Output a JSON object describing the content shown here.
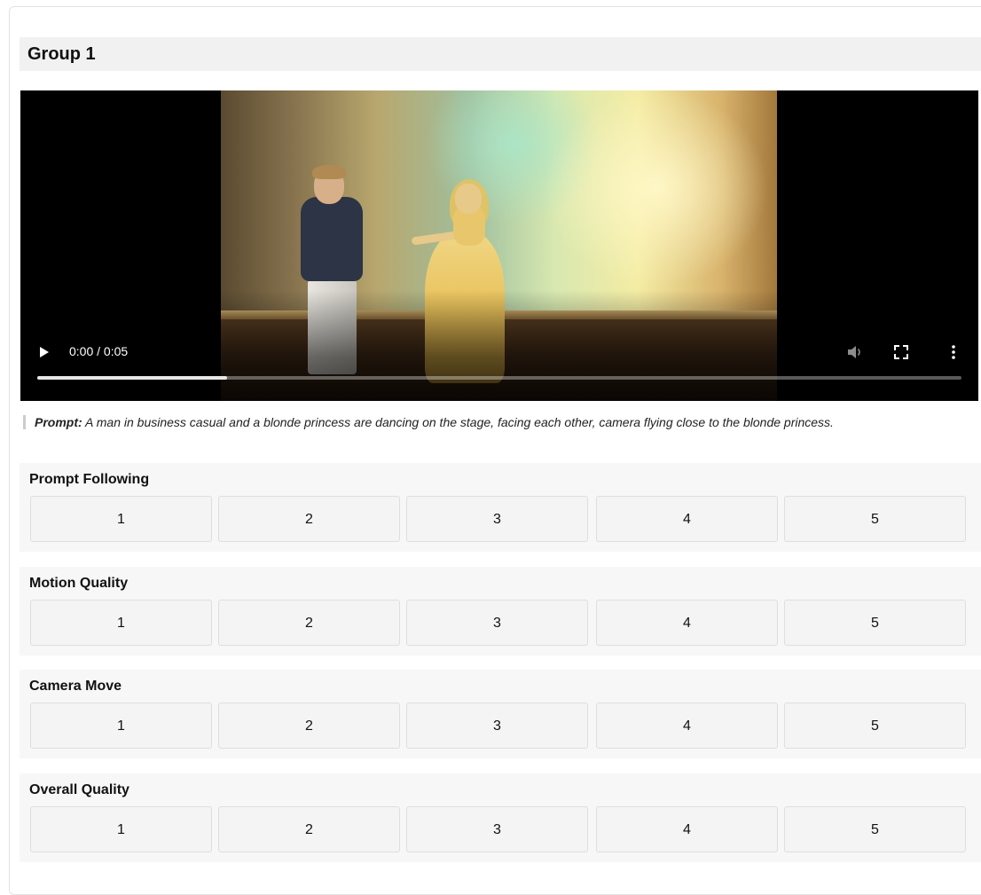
{
  "group": {
    "title": "Group 1"
  },
  "video": {
    "time": "0:00 / 0:05",
    "buffered_fraction": 0.205,
    "controls": {
      "play": "play-icon",
      "volume": "volume-icon",
      "fullscreen": "fullscreen-icon",
      "more": "more-options-icon"
    }
  },
  "prompt": {
    "label": "Prompt:",
    "text": "A man in business casual and a blonde princess are dancing on the stage, facing each other, camera flying close to the blonde princess."
  },
  "ratings": [
    {
      "label": "Prompt Following",
      "options": [
        "1",
        "2",
        "3",
        "4",
        "5"
      ]
    },
    {
      "label": "Motion Quality",
      "options": [
        "1",
        "2",
        "3",
        "4",
        "5"
      ]
    },
    {
      "label": "Camera Move",
      "options": [
        "1",
        "2",
        "3",
        "4",
        "5"
      ]
    },
    {
      "label": "Overall Quality",
      "options": [
        "1",
        "2",
        "3",
        "4",
        "5"
      ]
    }
  ]
}
